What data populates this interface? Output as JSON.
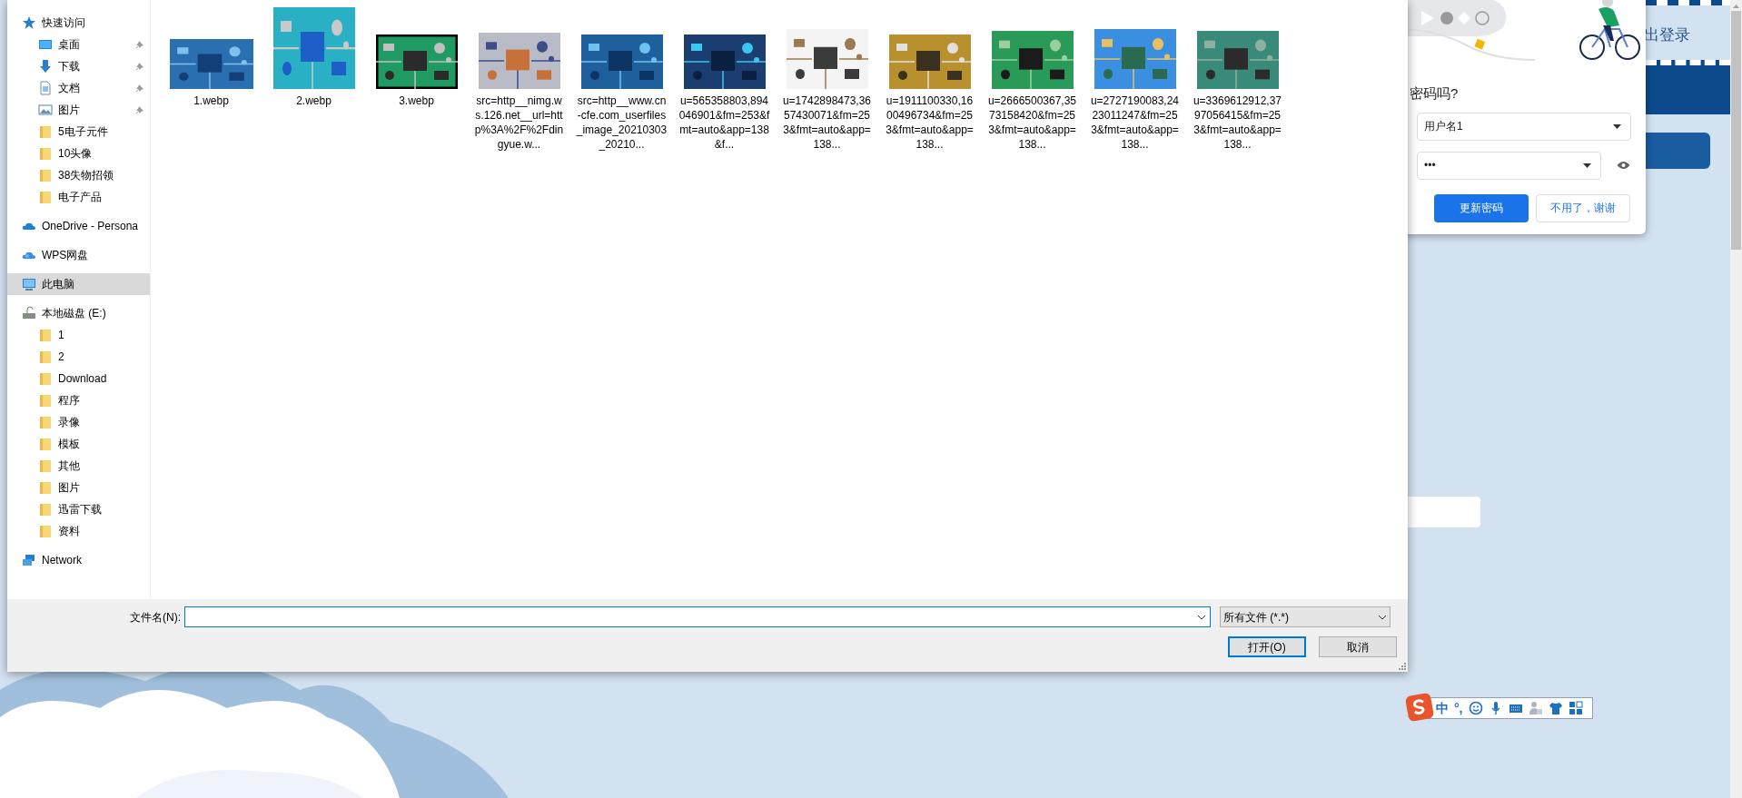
{
  "file_dialog": {
    "sidebar": [
      {
        "label": "快速访问",
        "kind": "star",
        "selected": false,
        "children": [
          {
            "label": "桌面",
            "kind": "desktop",
            "pinned": true,
            "selected": false
          },
          {
            "label": "下载",
            "kind": "download",
            "pinned": true,
            "selected": false
          },
          {
            "label": "文档",
            "kind": "document",
            "pinned": true,
            "selected": false
          },
          {
            "label": "图片",
            "kind": "pictures",
            "pinned": true,
            "selected": false
          },
          {
            "label": "5电子元件",
            "kind": "folder",
            "pinned": false,
            "selected": false
          },
          {
            "label": "10头像",
            "kind": "folder",
            "pinned": false,
            "selected": false
          },
          {
            "label": "38失物招领",
            "kind": "folder",
            "pinned": false,
            "selected": false
          },
          {
            "label": "电子产品",
            "kind": "folder",
            "pinned": false,
            "selected": false
          }
        ]
      },
      {
        "label": "OneDrive - Persona",
        "kind": "cloud",
        "selected": false
      },
      {
        "label": "WPS网盘",
        "kind": "cloud2",
        "selected": false
      },
      {
        "label": "此电脑",
        "kind": "pc",
        "selected": true
      },
      {
        "label": "本地磁盘 (E:)",
        "kind": "drive",
        "selected": false,
        "children": [
          {
            "label": "1",
            "kind": "folder",
            "pinned": false,
            "selected": false
          },
          {
            "label": "2",
            "kind": "folder",
            "pinned": false,
            "selected": false
          },
          {
            "label": "Download",
            "kind": "folder",
            "pinned": false,
            "selected": false
          },
          {
            "label": "程序",
            "kind": "folder",
            "pinned": false,
            "selected": false
          },
          {
            "label": "录像",
            "kind": "folder",
            "pinned": false,
            "selected": false
          },
          {
            "label": "模板",
            "kind": "folder",
            "pinned": false,
            "selected": false
          },
          {
            "label": "其他",
            "kind": "folder",
            "pinned": false,
            "selected": false
          },
          {
            "label": "图片",
            "kind": "folder",
            "pinned": false,
            "selected": false
          },
          {
            "label": "迅雷下载",
            "kind": "folder",
            "pinned": false,
            "selected": false
          },
          {
            "label": "资料",
            "kind": "folder",
            "pinned": false,
            "selected": false
          }
        ]
      },
      {
        "label": "Network",
        "kind": "network",
        "selected": false
      }
    ],
    "files": [
      {
        "name": "1.webp"
      },
      {
        "name": "2.webp"
      },
      {
        "name": "3.webp"
      },
      {
        "name": "src=http__nimg.ws.126.net__url=http%3A%2F%2Fdingyue.w..."
      },
      {
        "name": "src=http__www.cn-cfe.com_userfiles_image_20210303_20210..."
      },
      {
        "name": "u=565358803,894046901&fm=253&fmt=auto&app=138&f..."
      },
      {
        "name": "u=1742898473,3657430071&fm=253&fmt=auto&app=138..."
      },
      {
        "name": "u=1911100330,1600496734&fm=253&fmt=auto&app=138..."
      },
      {
        "name": "u=2666500367,3573158420&fm=253&fmt=auto&app=138..."
      },
      {
        "name": "u=2727190083,2423011247&fm=253&fmt=auto&app=138..."
      },
      {
        "name": "u=3369612912,3797056415&fm=253&fmt=auto&app=138..."
      }
    ],
    "file_name_label": "文件名(N):",
    "file_type": "所有文件 (*.*)",
    "buttons": [
      {
        "label": "打开(O)",
        "default": true
      },
      {
        "label": "取消",
        "default": false
      }
    ]
  },
  "password_popup": {
    "title": "密码吗?",
    "username": "用户名1",
    "password": "•••",
    "buttons": [
      {
        "label": "更新密码",
        "primary": true
      },
      {
        "label": "不用了，谢谢",
        "primary": false
      }
    ]
  },
  "page": {
    "link": "出登录"
  },
  "ime_toolbar": {
    "items": [
      "中",
      "°,"
    ]
  }
}
